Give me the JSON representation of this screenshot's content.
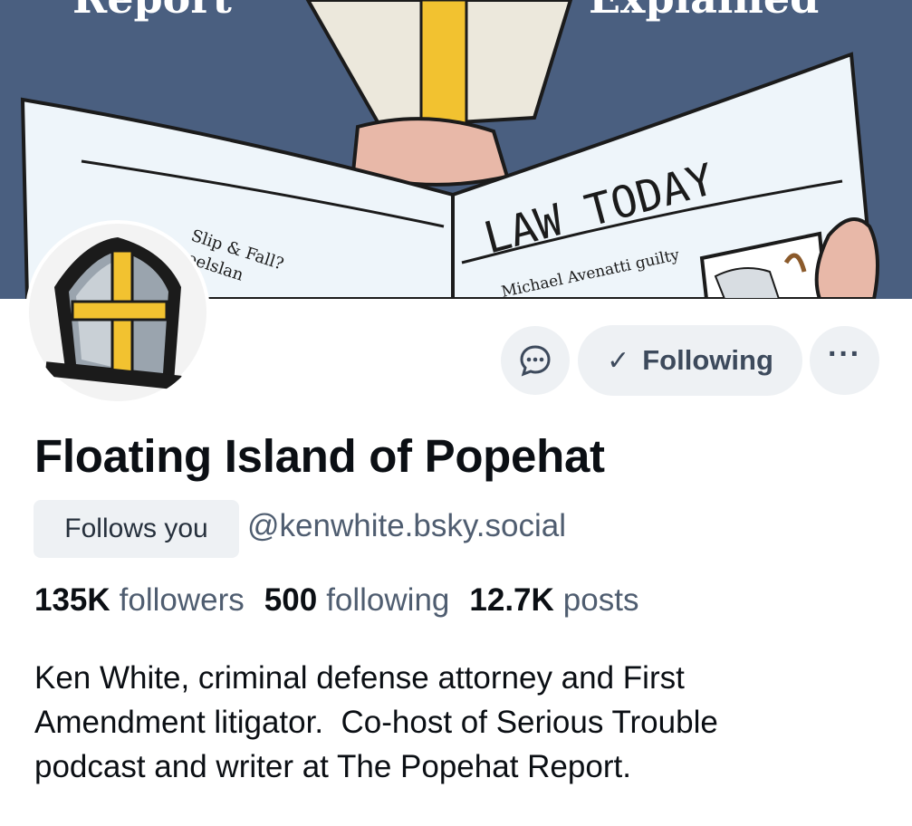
{
  "banner": {
    "top_left_text": "Report",
    "top_right_text": "Explained",
    "newspaper_title": "LAW TODAY",
    "headline_left_line1": "Slip & Fall?",
    "headline_left_line2": "oelslan",
    "headline_right": "Michael Avenatti guilty",
    "background_color": "#4a5f80"
  },
  "avatar": {
    "icon": "mitre-icon"
  },
  "actions": {
    "message_icon": "chat-bubble-icon",
    "following_check": "✓",
    "following_label": "Following",
    "more_icon": "ellipsis-icon",
    "more_label": "···"
  },
  "profile": {
    "display_name": "Floating Island of Popehat",
    "follows_you_label": "Follows you",
    "handle": "@kenwhite.bsky.social"
  },
  "stats": [
    {
      "value": "135K",
      "label": "followers"
    },
    {
      "value": "500",
      "label": "following"
    },
    {
      "value": "12.7K",
      "label": "posts"
    }
  ],
  "bio": {
    "line1": "Ken White, criminal defense attorney and First",
    "line2": "Amendment litigator.  Co-host of Serious Trouble",
    "line3": "podcast and writer at The Popehat Report."
  }
}
